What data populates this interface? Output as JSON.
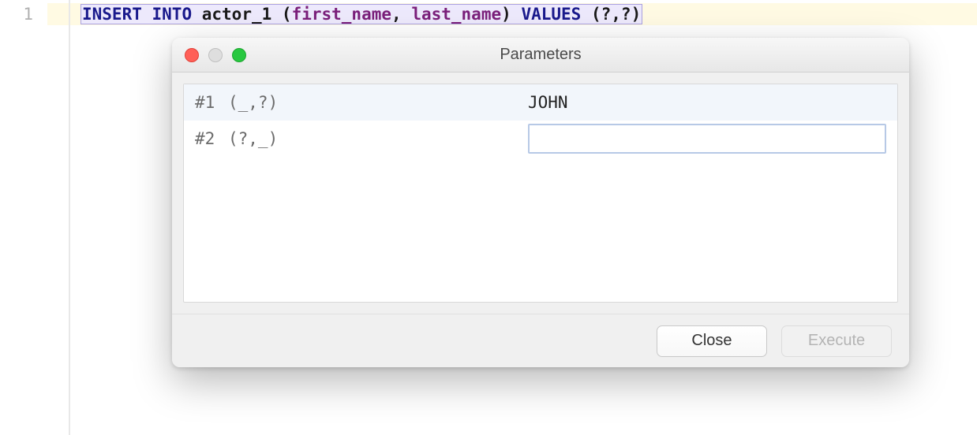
{
  "editor": {
    "line_number": "1",
    "tokens": {
      "insert": "INSERT",
      "into": "INTO",
      "table": "actor_1",
      "lparen1": "(",
      "col1": "first_name",
      "comma1": ",",
      "col2": "last_name",
      "rparen1": ")",
      "values_kw": "VALUES",
      "lparen2": "(",
      "q1": "?",
      "comma2": ",",
      "q2": "?",
      "rparen2": ")"
    }
  },
  "dialog": {
    "title": "Parameters",
    "params": [
      {
        "index": "#1",
        "signature": "(_,?)",
        "value": "JOHN"
      },
      {
        "index": "#2",
        "signature": "(?,_)",
        "value": ""
      }
    ],
    "buttons": {
      "close": "Close",
      "execute": "Execute"
    }
  }
}
